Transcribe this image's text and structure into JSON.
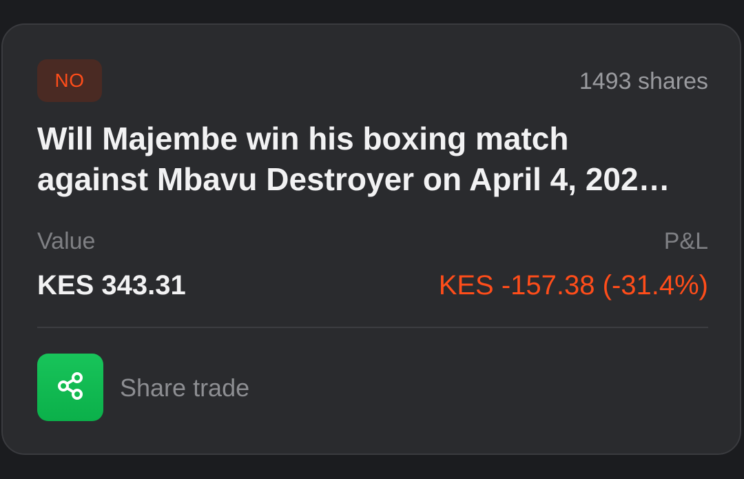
{
  "position": {
    "side": "NO",
    "shares": "1493 shares",
    "question_line1": "Will Majembe win his boxing match",
    "question_line2": "against Mbavu Destroyer on April 4, 202…",
    "value_label": "Value",
    "value_amount": "KES 343.31",
    "pl_label": "P&L",
    "pl_amount": "KES -157.38 (-31.4%)"
  },
  "share": {
    "label": "Share trade",
    "icon": "share-icon"
  },
  "colors": {
    "loss": "#ff4d1a",
    "share_button": "#11bb50",
    "card": "#2a2b2e",
    "background": "#1b1c1f"
  }
}
